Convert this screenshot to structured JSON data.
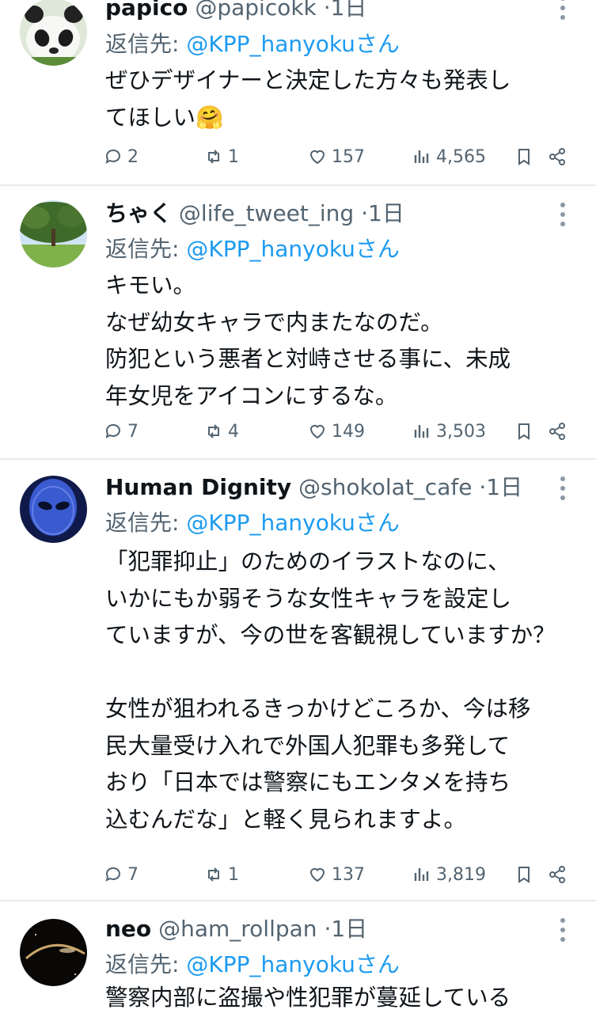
{
  "tweets": [
    {
      "name": "papico",
      "handle": "@papicokk",
      "time": "1日",
      "reply_label": "返信先: ",
      "reply_to": "@KPP_hanyokuさん",
      "text": "ぜひデザイナーと決定した方々も発表し\nてほしい🤗",
      "avatar_icon": "panda-avatar-icon",
      "stats": {
        "replies": "2",
        "reposts": "1",
        "likes": "157",
        "views": "4,565"
      }
    },
    {
      "name": "ちゃく",
      "handle": "@life_tweet_ing",
      "time": "1日",
      "reply_label": "返信先: ",
      "reply_to": "@KPP_hanyokuさん",
      "text": "キモい。\nなぜ幼女キャラで内またなのだ。\n防犯という悪者と対峙させる事に、未成\n年女児をアイコンにするな。",
      "avatar_icon": "tree-avatar-icon",
      "stats": {
        "replies": "7",
        "reposts": "4",
        "likes": "149",
        "views": "3,503"
      }
    },
    {
      "name": "Human Dignity",
      "handle": "@shokolat_cafe",
      "time": "1日",
      "reply_label": "返信先: ",
      "reply_to": "@KPP_hanyokuさん",
      "text": "「犯罪抑止」のためのイラストなのに、\nいかにもか弱そうな女性キャラを設定し\nていますが、今の世を客観視していますか？\n\n女性が狙われるきっかけどころか、今は移\n民大量受け入れで外国人犯罪も多発して\nおり「日本では警察にもエンタメを持ち\n込むんだな」と軽く見られますよ。",
      "avatar_icon": "alien-avatar-icon",
      "stats": {
        "replies": "7",
        "reposts": "1",
        "likes": "137",
        "views": "3,819"
      }
    },
    {
      "name": "neo",
      "handle": "@ham_rollpan",
      "time": "1日",
      "reply_label": "返信先: ",
      "reply_to": "@KPP_hanyokuさん",
      "text": "警察内部に盗撮や性犯罪が蔓延している",
      "avatar_icon": "space-avatar-icon"
    }
  ],
  "colors": {
    "link": "#1d9bf0",
    "muted": "#536471",
    "divider": "#e6eaec"
  }
}
